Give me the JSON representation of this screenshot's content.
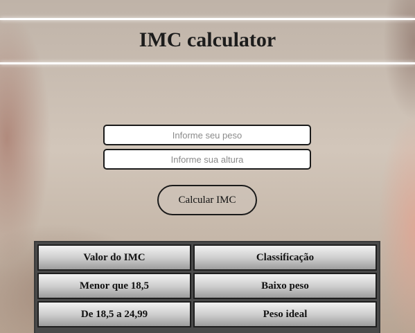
{
  "header": {
    "title": "IMC calculator"
  },
  "form": {
    "weight_placeholder": "Informe seu peso",
    "height_placeholder": "Informe sua altura",
    "calculate_label": "Calcular IMC"
  },
  "table": {
    "headers": [
      "Valor do IMC",
      "Classificação"
    ],
    "rows": [
      [
        "Menor que 18,5",
        "Baixo peso"
      ],
      [
        "De 18,5 a 24,99",
        "Peso ideal"
      ]
    ]
  }
}
